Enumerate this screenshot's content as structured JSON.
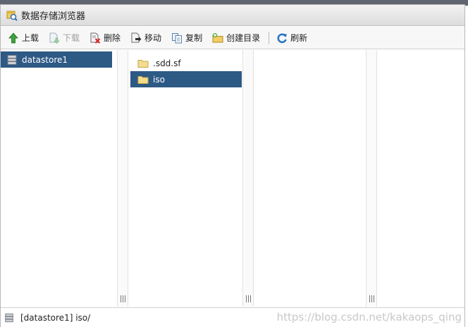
{
  "window": {
    "title": "数据存储浏览器"
  },
  "toolbar": {
    "upload": "上载",
    "download": "下载",
    "delete": "删除",
    "move": "移动",
    "copy": "复制",
    "create_folder": "创建目录",
    "refresh": "刷新"
  },
  "columns": {
    "datastores": [
      "datastore1"
    ],
    "folders": [
      ".sdd.sf",
      "iso"
    ],
    "selected_folder": "iso"
  },
  "status": {
    "path": "[datastore1] iso/"
  },
  "watermark": "https://blog.csdn.net/kakaops_qing",
  "colors": {
    "selection": "#2d5985",
    "titlebar": "#dcdcdc"
  }
}
